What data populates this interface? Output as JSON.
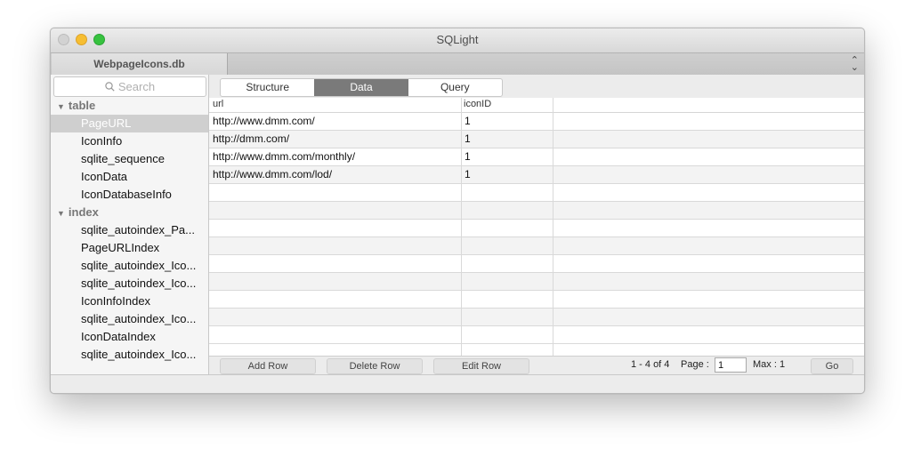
{
  "window": {
    "title": "SQLight"
  },
  "doc_tab": {
    "label": "WebpageIcons.db"
  },
  "search": {
    "placeholder": "Search"
  },
  "sidebar": {
    "sections": [
      {
        "label": "table",
        "items": [
          "PageURL",
          "IconInfo",
          "sqlite_sequence",
          "IconData",
          "IconDatabaseInfo"
        ]
      },
      {
        "label": "index",
        "items": [
          "sqlite_autoindex_Pa...",
          "PageURLIndex",
          "sqlite_autoindex_Ico...",
          "sqlite_autoindex_Ico...",
          "IconInfoIndex",
          "sqlite_autoindex_Ico...",
          "IconDataIndex",
          "sqlite_autoindex_Ico..."
        ]
      }
    ],
    "selected": "PageURL"
  },
  "tabs": {
    "structure": "Structure",
    "data": "Data",
    "query": "Query",
    "active": "Data"
  },
  "table": {
    "columns": [
      "url",
      "iconID"
    ],
    "rows": [
      [
        "http://www.dmm.com/",
        "1"
      ],
      [
        "http://dmm.com/",
        "1"
      ],
      [
        "http://www.dmm.com/monthly/",
        "1"
      ],
      [
        "http://www.dmm.com/lod/",
        "1"
      ]
    ]
  },
  "footer": {
    "add_row": "Add Row",
    "delete_row": "Delete Row",
    "edit_row": "Edit Row",
    "range": "1 - 4 of 4",
    "page_label": "Page :",
    "page_value": "1",
    "max_label": "Max : 1",
    "go": "Go"
  },
  "colors": {
    "selected_row": "#cfcfcf",
    "active_tab": "#7a7a7a",
    "close": "#d2d2d2",
    "minimize": "#f6be32",
    "maximize": "#37c23f"
  }
}
